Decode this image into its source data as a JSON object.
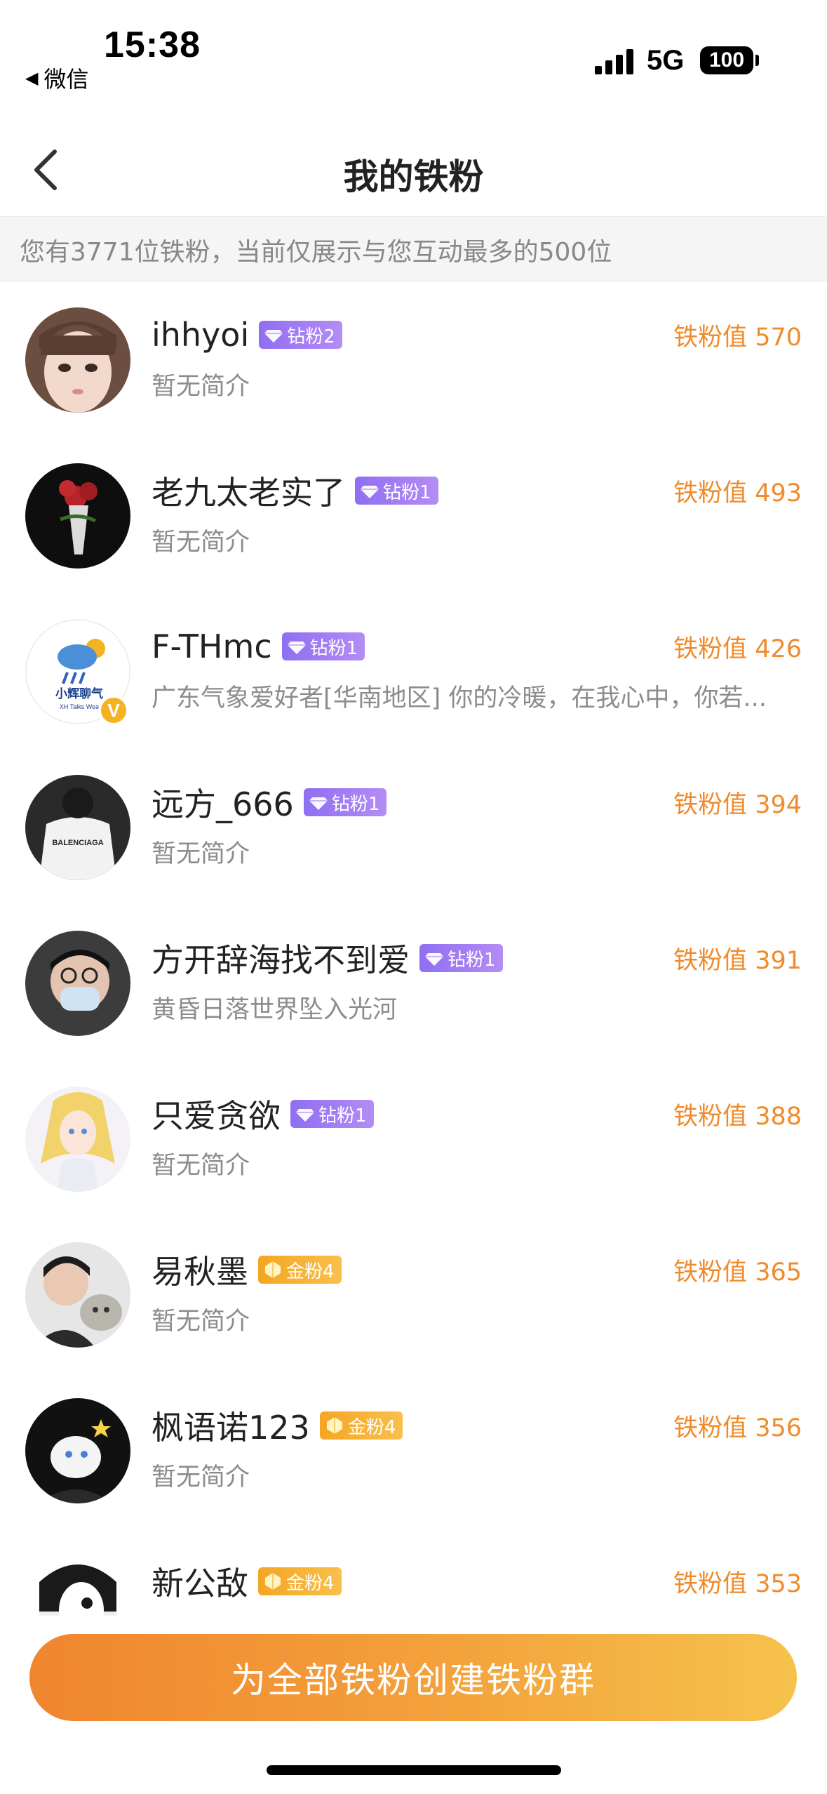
{
  "status_bar": {
    "time": "15:38",
    "back_app": "微信",
    "network": "5G",
    "battery": "100"
  },
  "nav": {
    "title": "我的铁粉"
  },
  "notice": "您有3771位铁粉，当前仅展示与您互动最多的500位",
  "fans": [
    {
      "name": "ihhyoi",
      "badge": "钻粉2",
      "badge_type": "diamond",
      "score": "铁粉值 570",
      "bio": "暂无简介"
    },
    {
      "name": "老九太老实了",
      "badge": "钻粉1",
      "badge_type": "diamond",
      "score": "铁粉值 493",
      "bio": "暂无简介"
    },
    {
      "name": "F-THmc",
      "badge": "钻粉1",
      "badge_type": "diamond",
      "score": "铁粉值 426",
      "bio": "广东气象爱好者[华南地区] 你的冷暖，在我心中，你若...",
      "avatar_text": "小辉聊气",
      "avatar_subtext": "XH Talks Wea",
      "verified": "V"
    },
    {
      "name": "远方_666",
      "badge": "钻粉1",
      "badge_type": "diamond",
      "score": "铁粉值 394",
      "bio": "暂无简介",
      "avatar_text": "BALENCIAGA"
    },
    {
      "name": "方开辞海找不到爱",
      "badge": "钻粉1",
      "badge_type": "diamond",
      "score": "铁粉值 391",
      "bio": "黄昏日落世界坠入光河"
    },
    {
      "name": "只爱贪欲",
      "badge": "钻粉1",
      "badge_type": "diamond",
      "score": "铁粉值 388",
      "bio": "暂无简介"
    },
    {
      "name": "易秋墨",
      "badge": "金粉4",
      "badge_type": "gold",
      "score": "铁粉值 365",
      "bio": "暂无简介"
    },
    {
      "name": "枫语诺123",
      "badge": "金粉4",
      "badge_type": "gold",
      "score": "铁粉值 356",
      "bio": "暂无简介"
    },
    {
      "name": "新公敌",
      "badge": "金粉4",
      "badge_type": "gold",
      "score": "铁粉值 353",
      "bio": ""
    }
  ],
  "create_button": "为全部铁粉创建铁粉群",
  "colors": {
    "accent_orange": "#f08a2a",
    "diamond_badge": "#9b78f3",
    "gold_badge": "#f5b02e"
  },
  "icons": {
    "nav_back": "chevron-left-icon",
    "diamond_badge": "diamond-icon",
    "gold_badge": "gold-gem-icon"
  }
}
